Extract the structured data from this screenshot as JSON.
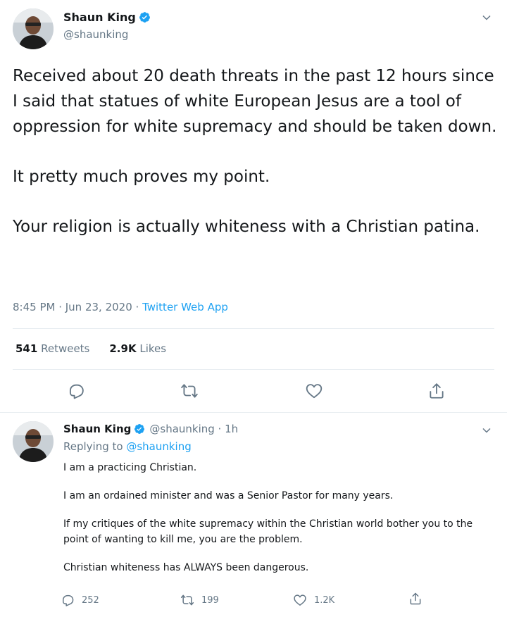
{
  "main_tweet": {
    "author_name": "Shaun King",
    "author_handle": "@shaunking",
    "paragraphs": [
      "Received about 20 death threats in the past 12 hours since I said that statues of white European Jesus are a tool of oppression for white supremacy and should be taken down.",
      "It pretty much proves my point.",
      "Your religion is actually whiteness with a Christian patina."
    ],
    "timestamp": "8:45 PM · Jun 23, 2020 · ",
    "source": "Twitter Web App",
    "retweets_count": "541",
    "retweets_label": "Retweets",
    "likes_count": "2.9K",
    "likes_label": "Likes"
  },
  "reply_tweet": {
    "author_name": "Shaun King",
    "author_handle": "@shaunking · 1h",
    "replying_prefix": "Replying to ",
    "replying_to": "@shaunking",
    "paragraphs": [
      "I am a practicing Christian.",
      "I am an ordained minister and was a Senior Pastor for many years.",
      "If my critiques of the white supremacy within the Christian world bother you to the point of wanting to kill me, you are the problem.",
      "Christian whiteness has ALWAYS been dangerous."
    ],
    "reply_count": "252",
    "retweet_count": "199",
    "like_count": "1.2K"
  },
  "icons": {
    "verified": "verified-badge-icon",
    "caret": "chevron-down-icon",
    "reply": "reply-icon",
    "retweet": "retweet-icon",
    "like": "heart-icon",
    "share": "share-icon"
  },
  "colors": {
    "accent": "#1da1f2",
    "secondary_text": "#657786",
    "primary_text": "#14171a",
    "divider": "#e6ecf0"
  }
}
